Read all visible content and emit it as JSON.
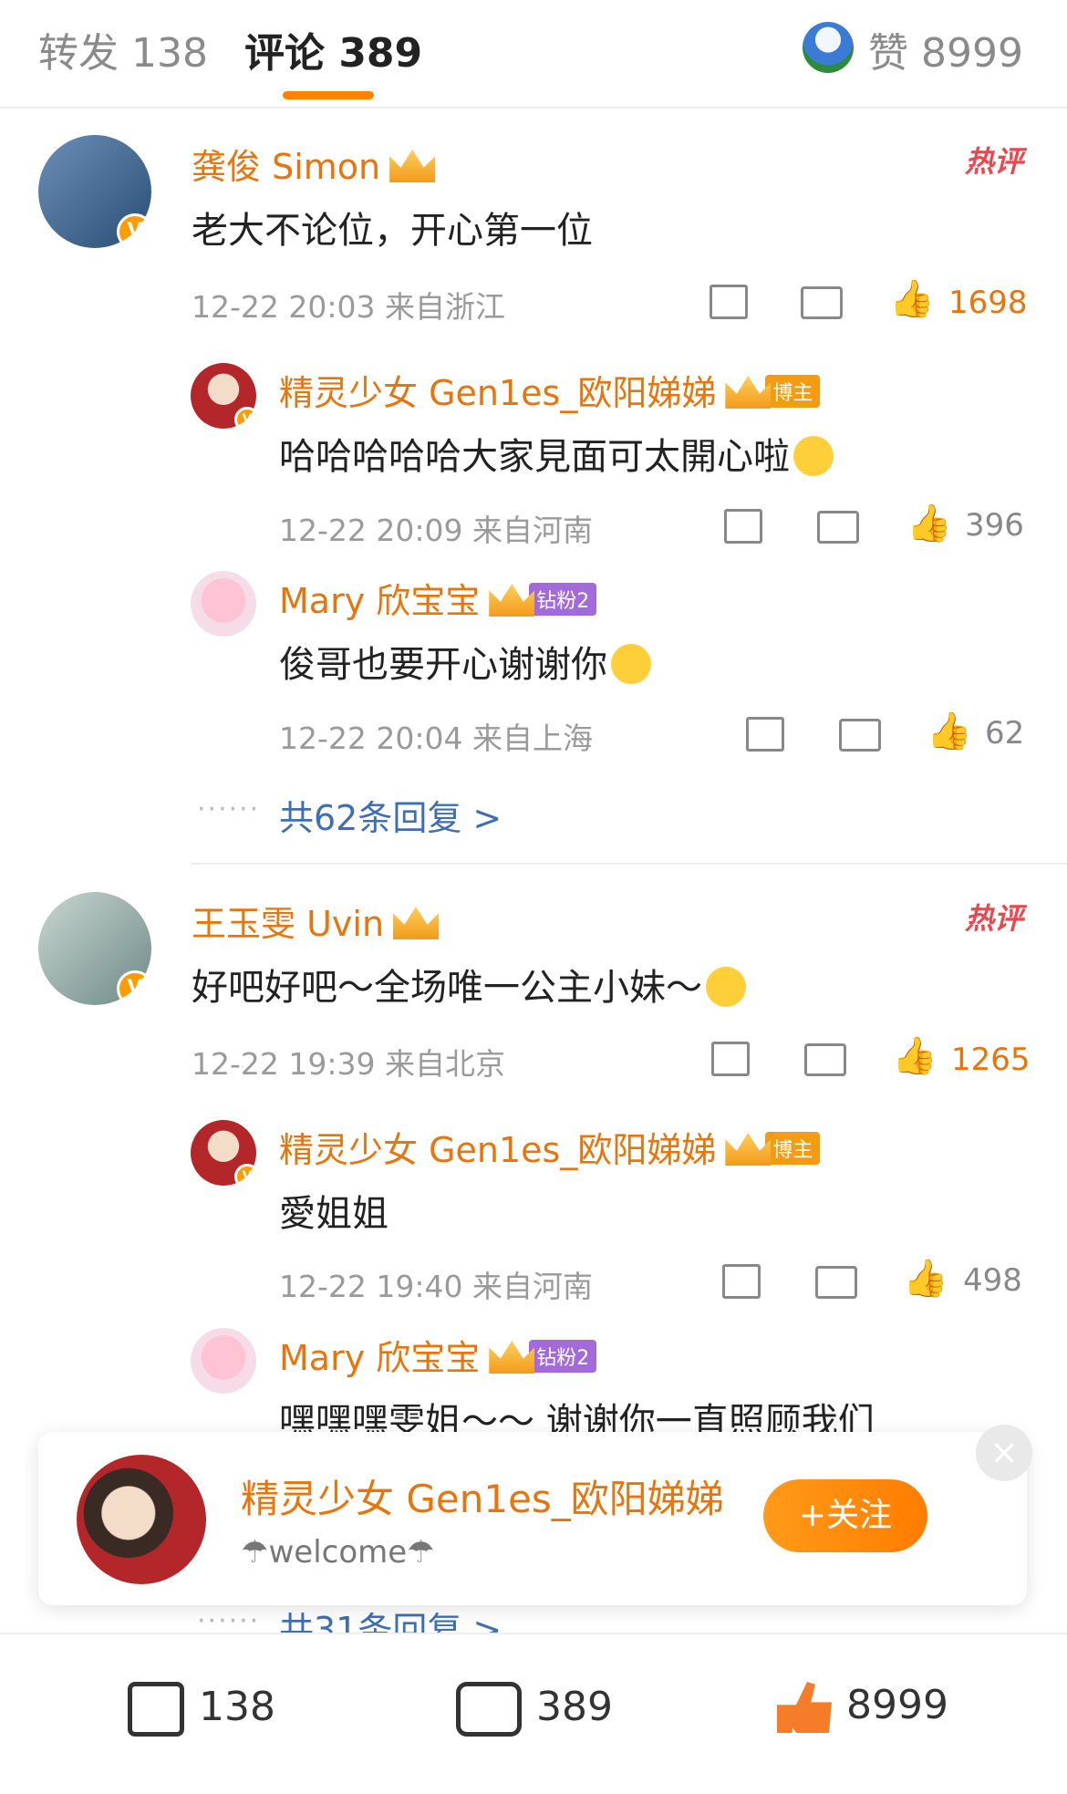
{
  "tabs": {
    "repost": "转发 138",
    "comment": "评论 389",
    "likes": "赞 8999"
  },
  "hot_label": "热评",
  "comments": [
    {
      "name": "龚俊 Simon",
      "text": "老大不论位，开心第一位",
      "meta": "12-22 20:03 来自浙江",
      "likes": "1698",
      "replies": [
        {
          "name": "精灵少女 Gen1es_欧阳娣娣",
          "tag": "博主",
          "text": "哈哈哈哈哈大家見面可太開心啦",
          "meta": "12-22 20:09 来自河南",
          "likes": "396"
        },
        {
          "name": "Mary 欣宝宝",
          "tag": "钻粉2",
          "text": "俊哥也要开心谢谢你",
          "meta": "12-22 20:04 来自上海",
          "likes": "62"
        }
      ],
      "more": "共62条回复 >"
    },
    {
      "name": "王玉雯 Uvin",
      "text": "好吧好吧～全场唯一公主小妹～",
      "meta": "12-22 19:39 来自北京",
      "likes": "1265",
      "replies": [
        {
          "name": "精灵少女 Gen1es_欧阳娣娣",
          "tag": "博主",
          "text": "愛姐姐",
          "meta": "12-22 19:40 来自河南",
          "likes": "498"
        },
        {
          "name": "Mary 欣宝宝",
          "tag": "钻粉2",
          "text": "嘿嘿嘿雯姐～～ 谢谢你一直照顾我们"
        }
      ],
      "more": "共31条回复 >"
    }
  ],
  "popup": {
    "name": "精灵少女 Gen1es_欧阳娣娣",
    "subtitle": "☂welcome☂",
    "follow": "+关注",
    "close": "×"
  },
  "bottom": {
    "share": "138",
    "comment": "389",
    "like": "8999"
  },
  "colors": {
    "accent": "#ff8200",
    "name": "#e8740c",
    "link": "#3f6fb0"
  },
  "icons": [
    "share-icon",
    "comment-icon",
    "thumb-up-icon",
    "crown-icon",
    "verified-icon",
    "close-icon"
  ]
}
